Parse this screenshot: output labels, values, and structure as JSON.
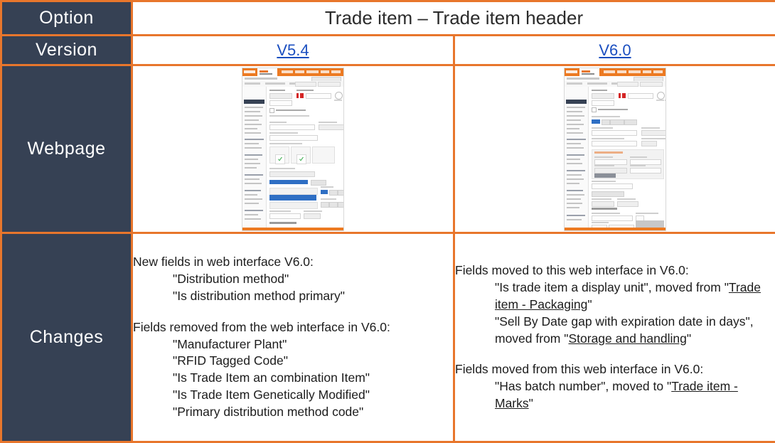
{
  "table": {
    "row_labels": {
      "option": "Option",
      "version": "Version",
      "webpage": "Webpage",
      "changes": "Changes"
    },
    "title": "Trade item – Trade item header",
    "versions": {
      "left": "V5.4",
      "right": "V6.0"
    }
  },
  "colors": {
    "border_orange": "#e8762c",
    "header_navy": "#364154",
    "link_blue": "#1b4fc0",
    "text": "#1c1c1c"
  },
  "changes_left": {
    "heading_new": "New fields in web interface V6.0:",
    "new_items": [
      "\"Distribution method\"",
      "\"Is distribution method primary\""
    ],
    "heading_removed": "Fields removed from the web interface in V6.0:",
    "removed_items": [
      "\"Manufacturer Plant\"",
      "\"RFID Tagged Code\"",
      "\"Is Trade Item an combination Item\"",
      "\"Is Trade Item Genetically Modified\"",
      "\"Primary distribution method code\""
    ]
  },
  "changes_right": {
    "heading_moved_to": "Fields moved to this web interface in V6.0:",
    "moved_to_items": [
      {
        "pre": "\"Is trade item a display unit\", moved from \"",
        "link": "Trade item - Packaging",
        "post": "\""
      },
      {
        "pre": "\"Sell By Date gap with expiration date in days\", moved from \"",
        "link": "Storage and handling",
        "post": "\""
      }
    ],
    "heading_moved_from": "Fields moved from this web interface in V6.0:",
    "moved_from_items": [
      {
        "pre": "\"Has batch number\", moved to \"",
        "link": "Trade item - Marks",
        "post": "\""
      }
    ]
  },
  "thumbnails": {
    "left": {
      "alt": "Screenshot of Trade item header web interface version 5.4"
    },
    "right": {
      "alt": "Screenshot of Trade item header web interface version 6.0"
    }
  }
}
